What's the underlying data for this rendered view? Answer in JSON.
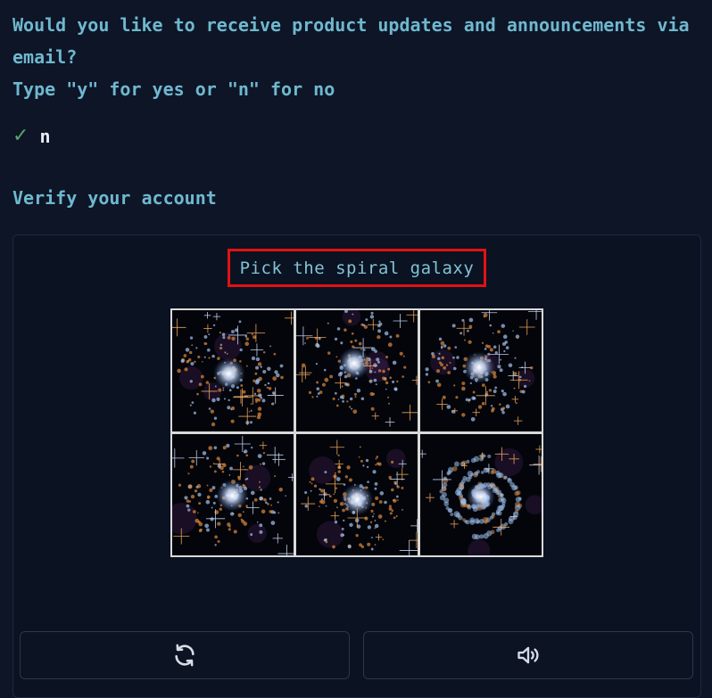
{
  "prompt": {
    "line1": "Would you like to receive product updates and announcements via",
    "line2": "email?",
    "line3": "Type \"y\" for yes or \"n\" for no",
    "answer_mark": "✓",
    "answer": "n"
  },
  "verify_heading": "Verify your account",
  "captcha": {
    "instruction": "Pick the spiral galaxy",
    "tiles": [
      {
        "kind": "irregular-galaxy"
      },
      {
        "kind": "irregular-galaxy"
      },
      {
        "kind": "irregular-galaxy"
      },
      {
        "kind": "irregular-galaxy"
      },
      {
        "kind": "irregular-galaxy"
      },
      {
        "kind": "spiral-galaxy"
      }
    ],
    "refresh_icon": "refresh-icon",
    "audio_icon": "speaker-icon"
  },
  "colors": {
    "background": "#0d1526",
    "prompt_text": "#6fb8cf",
    "highlight_border": "#e11212",
    "check": "#5aa36b"
  }
}
